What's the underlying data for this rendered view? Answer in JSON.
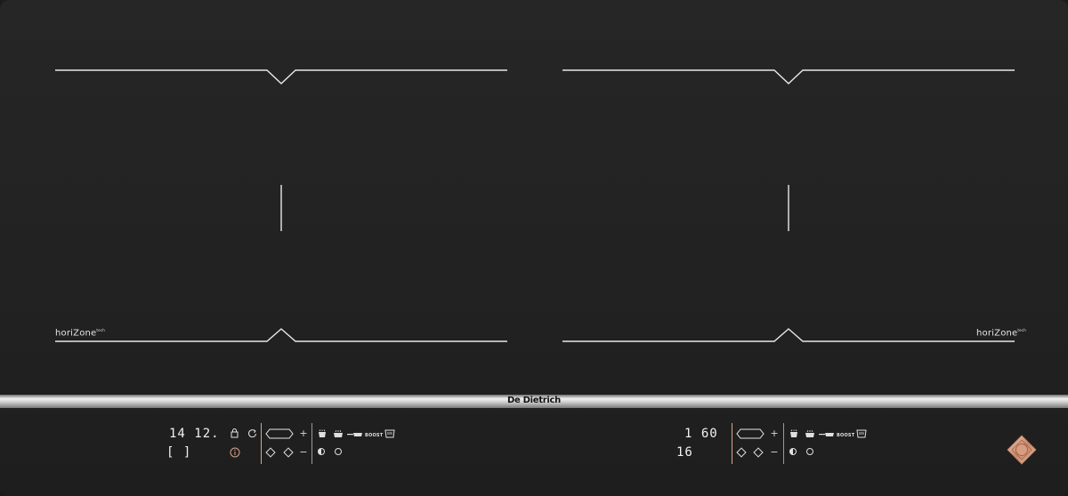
{
  "product": {
    "brand": "De Dietrich",
    "zone_label_left": "horiZone",
    "zone_label_left_sup": "tech",
    "zone_label_right": "horiZone",
    "zone_label_right_sup": "tech"
  },
  "left_panel": {
    "display_top": "14 12.",
    "display_bottom": "[ ]",
    "plus_label": "+",
    "minus_label": "−",
    "boost_label": "BOOST",
    "icons": [
      "lock-icon",
      "timer-reset-icon",
      "info-icon",
      "oval-zone-icon",
      "diamond-icon",
      "pot-icon",
      "grill-pan-icon",
      "fry-pan-icon",
      "steam-icon",
      "half-circle-icon",
      "circle-icon"
    ]
  },
  "right_panel": {
    "display_top": "1 60",
    "display_bottom": "16",
    "plus_label": "+",
    "minus_label": "−",
    "boost_label": "BOOST",
    "icons": [
      "oval-zone-icon",
      "diamond-icon",
      "pot-icon",
      "grill-pan-icon",
      "fry-pan-icon",
      "steam-icon",
      "half-circle-icon",
      "circle-icon"
    ]
  },
  "colors": {
    "glass": "#232323",
    "markings": "#e8e8e8",
    "accent": "#d9a58a"
  }
}
